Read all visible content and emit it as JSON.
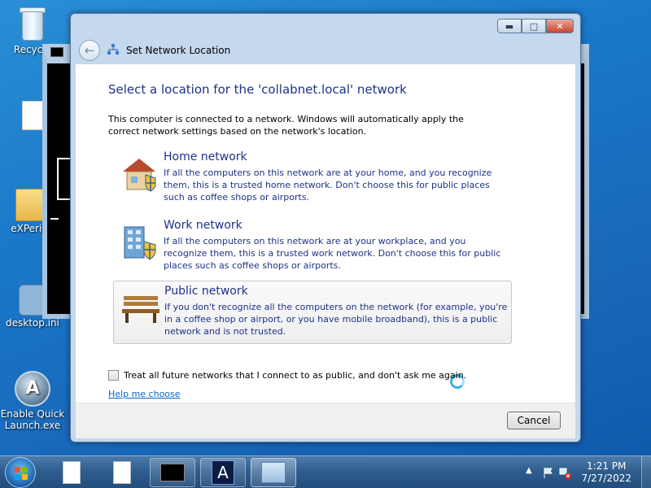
{
  "desktop": {
    "icons": [
      {
        "label": "Recycle"
      },
      {
        "label": ""
      },
      {
        "label": "eXPerie"
      },
      {
        "label": "desktop.ini"
      },
      {
        "label": "Enable Quick Launch.exe"
      }
    ]
  },
  "dialog": {
    "title": "Set Network Location",
    "heading": "Select a location for the 'collabnet.local' network",
    "intro": "This computer is connected to a network. Windows will automatically apply the correct network settings based on the network's location.",
    "options": [
      {
        "title": "Home network",
        "description": "If all the computers on this network are at your home, and you recognize them, this is a trusted home network.  Don't choose this for public places such as coffee shops or airports.",
        "icon": "house-icon"
      },
      {
        "title": "Work network",
        "description": "If all the computers on this network are at your workplace, and you recognize them, this is a trusted work network.  Don't choose this for public places such as coffee shops or airports.",
        "icon": "office-building-icon"
      },
      {
        "title": "Public network",
        "description": "If you don't recognize all the computers on the network (for example, you're in a coffee shop or airport, or you have mobile broadband), this is a public network and is not trusted.",
        "icon": "park-bench-icon"
      }
    ],
    "checkbox_label": "Treat all future networks that I connect to as public, and don't ask me again.",
    "checkbox_checked": false,
    "help_link": "Help me choose",
    "cancel_label": "Cancel"
  },
  "taskbar": {
    "clock_time": "1:21 PM",
    "clock_date": "7/27/2022"
  },
  "colors": {
    "accent_heading": "#1e3287",
    "link": "#0066cc",
    "desktop_bg": "#1a78c9"
  }
}
